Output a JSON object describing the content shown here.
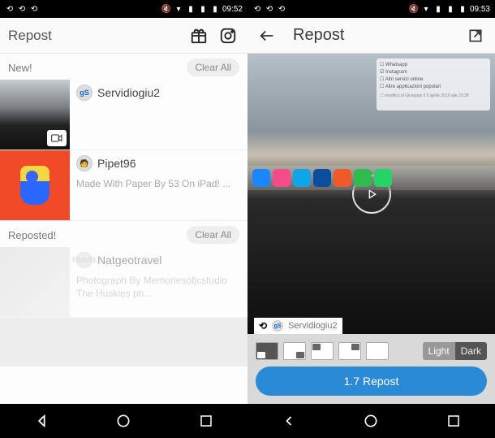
{
  "statusbar": {
    "time_left": "09:52",
    "time_right": "09:53"
  },
  "screen_a": {
    "title": "Repost",
    "sections": {
      "new_label": "New!",
      "reposted_label": "Reposted!",
      "clear_label_1": "Clear All",
      "clear_label_2": "Clear All"
    },
    "items": [
      {
        "username": "Servidiogiu2",
        "avatar_text": "gS",
        "has_video": true,
        "caption": ""
      },
      {
        "username": "Pipet96",
        "avatar_text": "",
        "has_video": false,
        "caption": "Made With Paper By 53 On iPad! ..."
      }
    ],
    "reposted_items": [
      {
        "username": "Natgeotravel",
        "avatar_text": "TRAVEL",
        "caption": "Photograph By Memoriesofjcstudio The Huskies ph..."
      }
    ]
  },
  "screen_b": {
    "title": "Repost",
    "badge_user": "Servidiogiu2",
    "badge_avatar": "gS",
    "checklist": [
      "Whatsapp",
      "Instagram",
      "Altri servizi online",
      "Altre applicazioni popolari"
    ],
    "checklist_sub": "modifica di Giuseppe il 9 aprile 2019 alle 20:28",
    "controls": {
      "light_label": "Light",
      "dark_label": "Dark",
      "repost_button": "1.7 Repost"
    }
  }
}
